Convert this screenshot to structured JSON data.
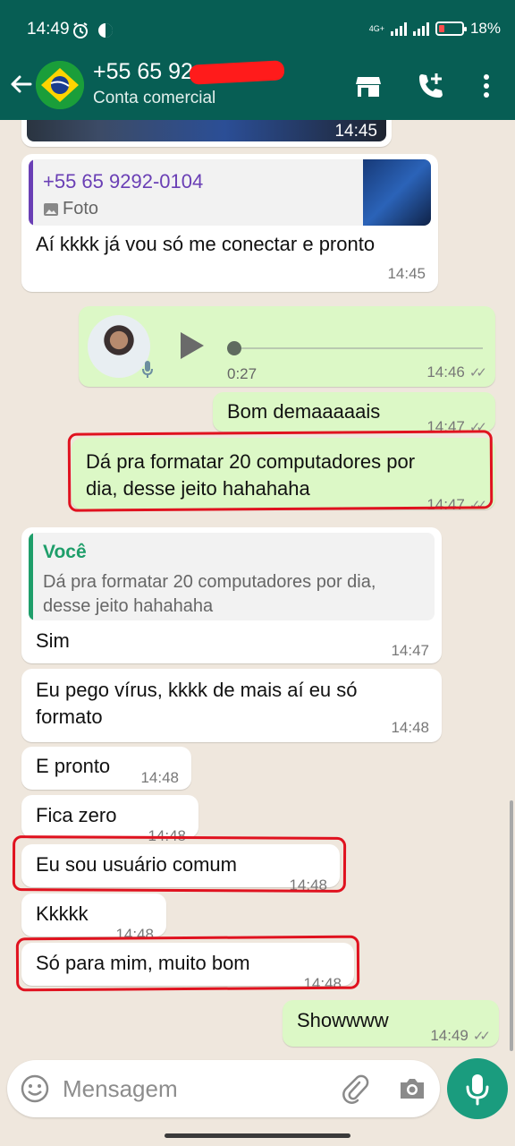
{
  "status_bar": {
    "time": "14:49",
    "network": "4G+",
    "battery": "18%"
  },
  "header": {
    "contact_name": "+55 65 92",
    "subtitle": "Conta comercial"
  },
  "messages": {
    "top_media": {
      "time": "14:45"
    },
    "m1": {
      "quote_name": "+55 65 9292-0104",
      "quote_text": "Foto",
      "text": "Aí kkkk já vou só me conectar e pronto",
      "time": "14:45"
    },
    "m2": {
      "duration": "0:27",
      "time": "14:46"
    },
    "m3": {
      "text": "Bom demaaaaais",
      "time": "14:47"
    },
    "m4": {
      "text": "Dá pra formatar 20 computadores por\ndia, desse jeito hahahaha",
      "time": "14:47"
    },
    "m5": {
      "quote_name": "Você",
      "quote_text": "Dá pra formatar 20 computadores por dia,\ndesse jeito hahahaha",
      "text": "Sim",
      "time": "14:47"
    },
    "m6": {
      "text": "Eu pego vírus, kkkk de mais aí eu só\nformato",
      "time": "14:48"
    },
    "m7": {
      "text": "E pronto",
      "time": "14:48"
    },
    "m8": {
      "text": "Fica zero",
      "time": "14:48"
    },
    "m9": {
      "text": "Eu sou usuário comum",
      "time": "14:48"
    },
    "m10": {
      "text": "Kkkkk",
      "time": "14:48"
    },
    "m11": {
      "text": "Só para mim, muito bom",
      "time": "14:48"
    },
    "m12": {
      "text": "Showwww",
      "time": "14:49"
    }
  },
  "input": {
    "placeholder": "Mensagem"
  },
  "colors": {
    "header": "#075e54",
    "chat_bg": "#efe7dd",
    "outgoing": "#dcf8c6",
    "incoming": "#ffffff",
    "read_ticks": "#888888",
    "annotation_red": "#e0121f",
    "quote_contact": "#6a3fb5",
    "quote_self": "#1e9e6a",
    "send_button": "#1a9c7e"
  },
  "icons": [
    "alarm-icon",
    "data-saver-icon",
    "signal-icon",
    "battery-icon",
    "back-arrow-icon",
    "brazil-flag-icon",
    "store-icon",
    "add-call-icon",
    "more-vert-icon",
    "image-icon",
    "play-icon",
    "mic-icon",
    "emoji-icon",
    "attach-icon",
    "camera-icon"
  ]
}
